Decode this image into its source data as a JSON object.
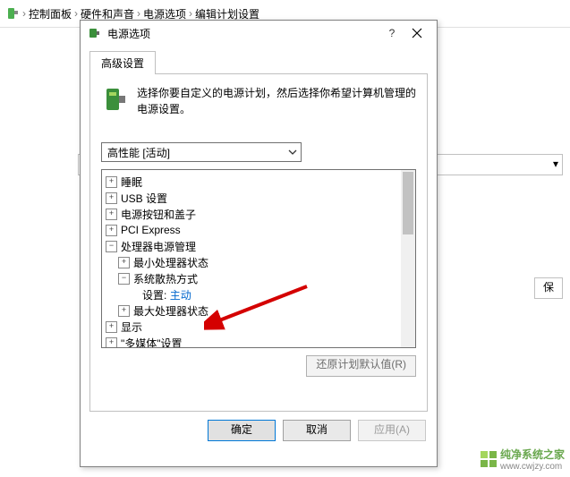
{
  "breadcrumb": {
    "items": [
      "控制面板",
      "硬件和声音",
      "电源选项",
      "编辑计划设置"
    ]
  },
  "bg": {
    "save_btn": "保"
  },
  "dialog": {
    "title": "电源选项",
    "tab": "高级设置",
    "description": "选择你要自定义的电源计划，然后选择你希望计算机管理的电源设置。",
    "plan_selected": "高性能 [活动]",
    "tree": {
      "sleep": "睡眠",
      "usb": "USB 设置",
      "power_buttons": "电源按钮和盖子",
      "pci": "PCI Express",
      "cpu_mgmt": "处理器电源管理",
      "min_state": "最小处理器状态",
      "cooling": "系统散热方式",
      "setting_label": "设置:",
      "setting_value": "主动",
      "max_state": "最大处理器状态",
      "display": "显示",
      "multimedia": "\"多媒体\"设置"
    },
    "restore_defaults": "还原计划默认值(R)",
    "ok": "确定",
    "cancel": "取消",
    "apply": "应用(A)"
  },
  "watermark": {
    "name": "纯净系统之家",
    "url": "www.cwjzy.com"
  }
}
